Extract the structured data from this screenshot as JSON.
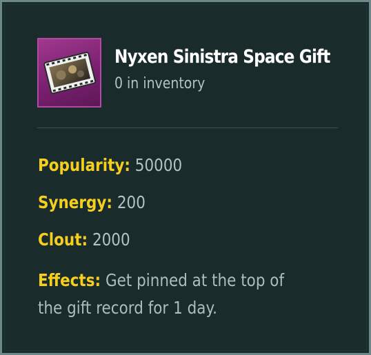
{
  "item": {
    "name": "Nyxen Sinistra Space Gift",
    "inventory": "0 in inventory",
    "icon": "film-reel-gift-icon",
    "rarity_color": "#a0398f"
  },
  "stats": {
    "popularity_label": "Popularity:",
    "popularity_value": "50000",
    "synergy_label": "Synergy:",
    "synergy_value": "200",
    "clout_label": "Clout:",
    "clout_value": "2000",
    "effects_label": "Effects:",
    "effects_value": "Get pinned at the top of the gift record for 1 day."
  },
  "colors": {
    "background": "#192b2b",
    "border": "#6d8888",
    "label": "#f5cf1f",
    "value": "#b4c2c2",
    "title": "#ffffff"
  }
}
